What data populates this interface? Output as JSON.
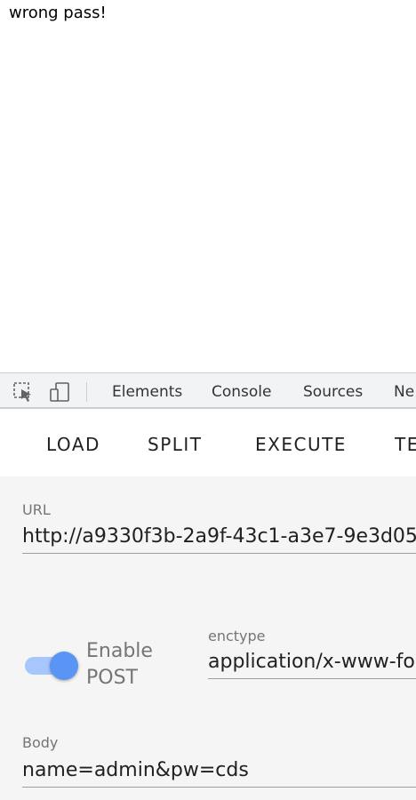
{
  "page": {
    "message": "wrong pass!"
  },
  "devtools": {
    "tabs": [
      "Elements",
      "Console",
      "Sources",
      "Ne"
    ]
  },
  "hackbar": {
    "buttons": [
      "LOAD",
      "SPLIT",
      "EXECUTE",
      "TE"
    ],
    "url": {
      "label": "URL",
      "value": "http://a9330f3b-2a9f-43c1-a3e7-9e3d05"
    },
    "post_toggle": {
      "label_line1": "Enable",
      "label_line2": "POST",
      "enabled": true
    },
    "enctype": {
      "label": "enctype",
      "value": "application/x-www-fo"
    },
    "body": {
      "label": "Body",
      "value": "name=admin&pw=cds"
    }
  }
}
